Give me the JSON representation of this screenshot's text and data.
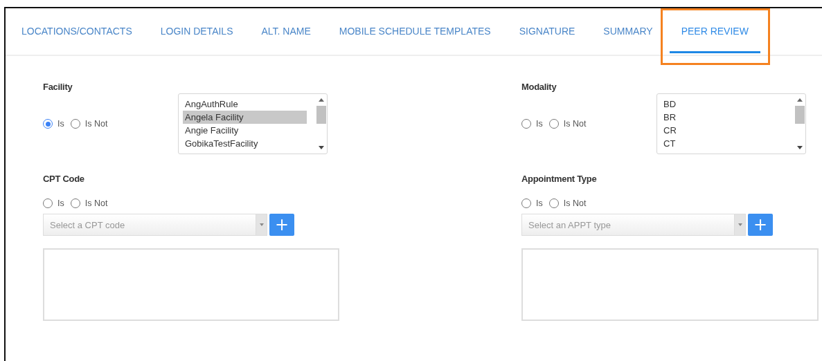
{
  "tabs": [
    {
      "label": "LOCATIONS/CONTACTS",
      "selected": false
    },
    {
      "label": "LOGIN DETAILS",
      "selected": false
    },
    {
      "label": "ALT. NAME",
      "selected": false
    },
    {
      "label": "MOBILE SCHEDULE TEMPLATES",
      "selected": false
    },
    {
      "label": "SIGNATURE",
      "selected": false
    },
    {
      "label": "SUMMARY",
      "selected": false
    },
    {
      "label": "PEER REVIEW",
      "selected": true
    }
  ],
  "filters": [
    {
      "kind": "listbox",
      "label": "Facility",
      "options": [
        {
          "label": "Is",
          "selected": true
        },
        {
          "label": "Is Not",
          "selected": false
        }
      ],
      "items": [
        {
          "label": "AngAuthRule",
          "selected": false
        },
        {
          "label": "Angela Facility",
          "selected": true
        },
        {
          "label": "Angie Facility",
          "selected": false
        },
        {
          "label": "GobikaTestFacility",
          "selected": false
        }
      ]
    },
    {
      "kind": "listbox",
      "label": "Modality",
      "options": [
        {
          "label": "Is",
          "selected": false
        },
        {
          "label": "Is Not",
          "selected": false
        }
      ],
      "items": [
        {
          "label": "BD",
          "selected": false
        },
        {
          "label": "BR",
          "selected": false
        },
        {
          "label": "CR",
          "selected": false
        },
        {
          "label": "CT",
          "selected": false
        }
      ]
    },
    {
      "kind": "picker",
      "label": "CPT Code",
      "options": [
        {
          "label": "Is",
          "selected": false
        },
        {
          "label": "Is Not",
          "selected": false
        }
      ],
      "placeholder": "Select a CPT code",
      "add_button": "+"
    },
    {
      "kind": "picker",
      "label": "Appointment Type",
      "options": [
        {
          "label": "Is",
          "selected": false
        },
        {
          "label": "Is Not",
          "selected": false
        }
      ],
      "placeholder": "Select an APPT type",
      "add_button": "+"
    }
  ]
}
